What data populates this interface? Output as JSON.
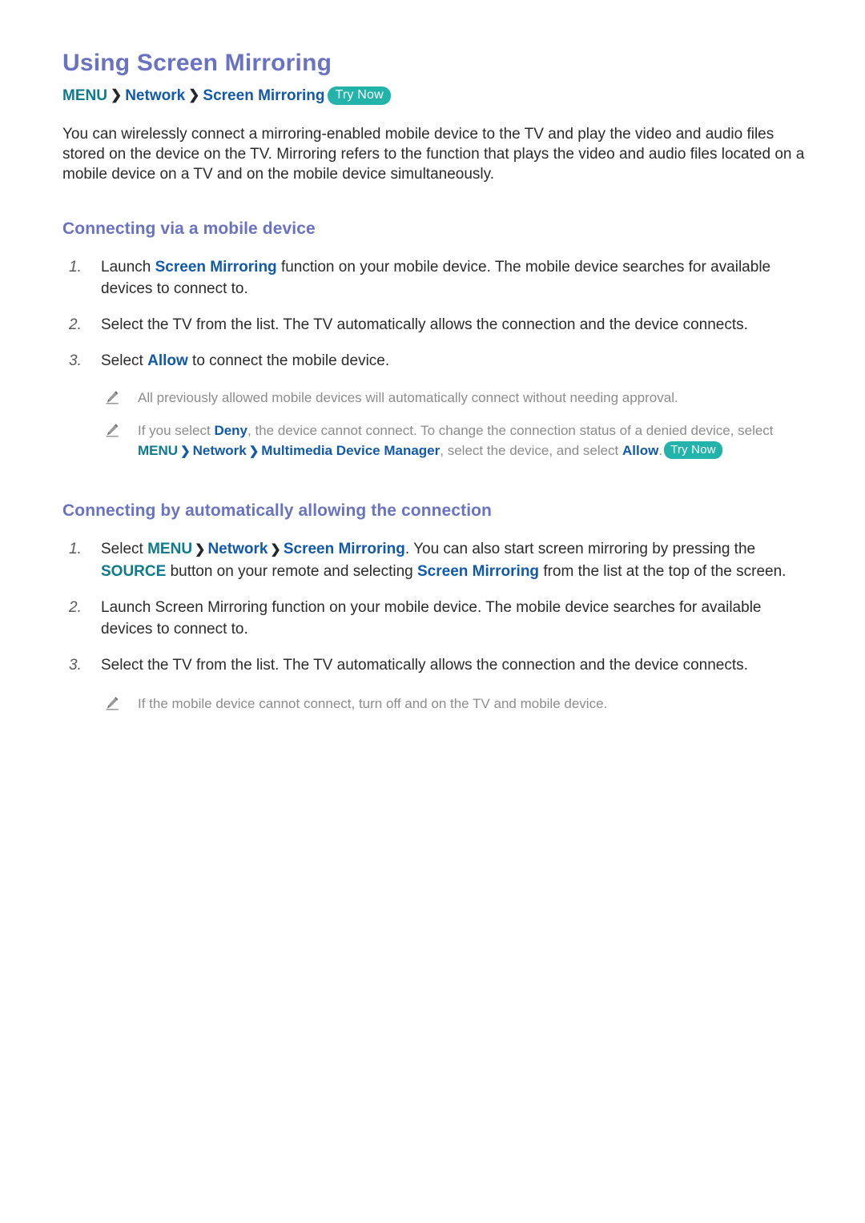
{
  "doc": {
    "title": "Using Screen Mirroring",
    "try_now_label": "Try Now"
  },
  "breadcrumb": {
    "menu": "MENU",
    "separator": "❯",
    "network": "Network",
    "screen_mirroring": "Screen Mirroring",
    "try_now": "Try Now"
  },
  "intro": {
    "text": "You can wirelessly connect a mirroring-enabled mobile device to the TV and play the video and audio files stored on the device on the TV. Mirroring refers to the function that plays the video and audio files located on a mobile device on a TV and on the mobile device simultaneously."
  },
  "section1": {
    "heading": "Connecting via a mobile device",
    "steps": [
      {
        "num": "1.",
        "pre": "Launch ",
        "link": "Screen Mirroring",
        "post": " function on your mobile device. The mobile device searches for available devices to connect to."
      },
      {
        "num": "2.",
        "pre": "Select the TV from the list. The TV automatically allows the connection and the device connects.",
        "link": "",
        "post": ""
      },
      {
        "num": "3.",
        "pre": "Select ",
        "link": "Allow",
        "post": " to connect the mobile device."
      }
    ],
    "notes": [
      {
        "icon": "pencil-icon",
        "text": "All previously allowed mobile devices will automatically connect without needing approval."
      },
      {
        "icon": "pencil-icon",
        "part1": "If you select ",
        "deny": "Deny",
        "part2": ", the device cannot connect. To change the connection status of a denied device, select ",
        "menu": "MENU",
        "sep": "❯",
        "network": "Network",
        "manager": "Multimedia Device Manager",
        "part3": ", select the device, and select ",
        "allow": "Allow",
        "part4": ".",
        "try_now": "Try Now"
      }
    ]
  },
  "section2": {
    "heading": "Connecting by automatically allowing the connection",
    "steps": [
      {
        "num": "1.",
        "p1": "Select ",
        "menu": "MENU",
        "sep": "❯",
        "network": "Network",
        "screen_mirroring": "Screen Mirroring",
        "p2": ". You can also start screen mirroring by pressing the ",
        "source": "SOURCE",
        "p3": " button on your remote and selecting ",
        "screen_mirroring2": "Screen Mirroring",
        "p4": " from the list at the top of the screen."
      },
      {
        "num": "2.",
        "text": "Launch Screen Mirroring function on your mobile device. The mobile device searches for available devices to connect to."
      },
      {
        "num": "3.",
        "text": "Select the TV from the list. The TV automatically allows the connection and the device connects."
      }
    ],
    "notes": [
      {
        "icon": "pencil-icon",
        "text": "If the mobile device cannot connect, turn off and on the TV and mobile device."
      }
    ]
  },
  "colors": {
    "title_purple": "#6a72c2",
    "menu_teal": "#0e7b8c",
    "link_blue": "#1259a8",
    "badge_teal": "#22b3ab",
    "body_text": "#2b2b2b",
    "note_text": "#8c8c8c"
  }
}
